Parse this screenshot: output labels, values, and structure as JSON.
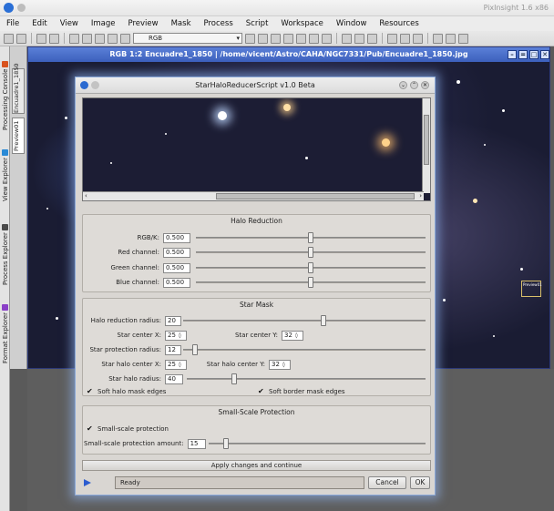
{
  "app": {
    "name_short": "PixInsight 1.6 x86"
  },
  "menu": [
    "File",
    "Edit",
    "View",
    "Image",
    "Preview",
    "Mask",
    "Process",
    "Script",
    "Workspace",
    "Window",
    "Resources"
  ],
  "toolbar": {
    "color_space": "RGB"
  },
  "left_tabs": [
    "Processing Console",
    "View Explorer",
    "Process Explorer",
    "Format Explorer"
  ],
  "preview_strip": [
    "Encuadre1_1850",
    "Preview01"
  ],
  "image_window": {
    "title": "RGB 1:2 Encuadre1_1850 | /home/vicent/Astro/CAHA/NGC7331/Pub/Encuadre1_1850.jpg",
    "marker_label": "Preview01"
  },
  "dialog": {
    "title": "StarHaloReducerScript v1.0 Beta",
    "halo_reduction": {
      "title": "Halo Reduction",
      "rows": [
        {
          "label": "RGB/K:",
          "value": "0.500",
          "position": 0.5
        },
        {
          "label": "Red channel:",
          "value": "0.500",
          "position": 0.5
        },
        {
          "label": "Green channel:",
          "value": "0.500",
          "position": 0.5
        },
        {
          "label": "Blue channel:",
          "value": "0.500",
          "position": 0.5
        }
      ]
    },
    "star_mask": {
      "title": "Star Mask",
      "halo_radius_label": "Halo reduction radius:",
      "halo_radius_value": "20",
      "halo_radius_position": 0.58,
      "star_center_x_label": "Star center X:",
      "star_center_x_value": "25",
      "star_center_y_label": "Star center Y:",
      "star_center_y_value": "32",
      "protection_radius_label": "Star protection radius:",
      "protection_radius_value": "12",
      "protection_radius_position": 0.05,
      "halo_center_x_label": "Star halo center X:",
      "halo_center_x_value": "25",
      "halo_center_y_label": "Star halo center Y:",
      "halo_center_y_value": "32",
      "halo_radius2_label": "Star halo radius:",
      "halo_radius2_value": "40",
      "halo_radius2_position": 0.2,
      "soft_halo_label": "Soft halo mask edges",
      "soft_border_label": "Soft border mask edges"
    },
    "small_scale": {
      "title": "Small-Scale Protection",
      "checkbox_label": "Small-scale protection",
      "amount_label": "Small-scale protection amount:",
      "amount_value": "15",
      "amount_position": 0.08
    },
    "apply_label": "Apply changes and continue",
    "status": "Ready",
    "cancel_label": "Cancel",
    "ok_label": "OK"
  }
}
